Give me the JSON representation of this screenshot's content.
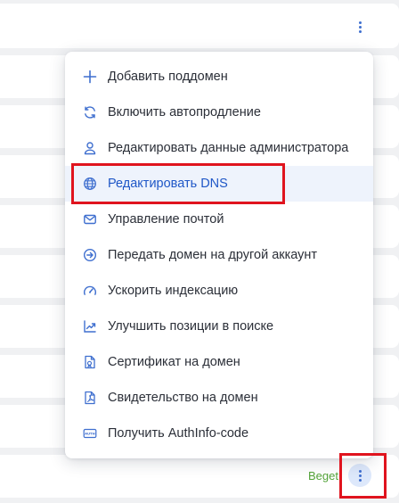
{
  "menu": {
    "items": [
      {
        "label": "Добавить поддомен",
        "icon": "plus-icon"
      },
      {
        "label": "Включить автопродление",
        "icon": "refresh-icon"
      },
      {
        "label": "Редактировать данные администратора",
        "icon": "user-icon"
      },
      {
        "label": "Редактировать DNS",
        "icon": "globe-icon",
        "active": true
      },
      {
        "label": "Управление почтой",
        "icon": "mail-icon"
      },
      {
        "label": "Передать домен на другой аккаунт",
        "icon": "arrow-circle-right-icon"
      },
      {
        "label": "Ускорить индексацию",
        "icon": "speedometer-icon"
      },
      {
        "label": "Улучшить позиции в поиске",
        "icon": "chart-up-icon"
      },
      {
        "label": "Сертификат на домен",
        "icon": "certificate-doc-icon"
      },
      {
        "label": "Свидетельство на домен",
        "icon": "pdf-doc-icon"
      },
      {
        "label": "Получить AuthInfo-code",
        "icon": "auth-icon"
      }
    ]
  },
  "row": {
    "provider_label": "Beget"
  },
  "colors": {
    "accent": "#1f57c7",
    "icon": "#3f6fcf",
    "annotation": "#e0141e",
    "provider": "#53a33a"
  }
}
